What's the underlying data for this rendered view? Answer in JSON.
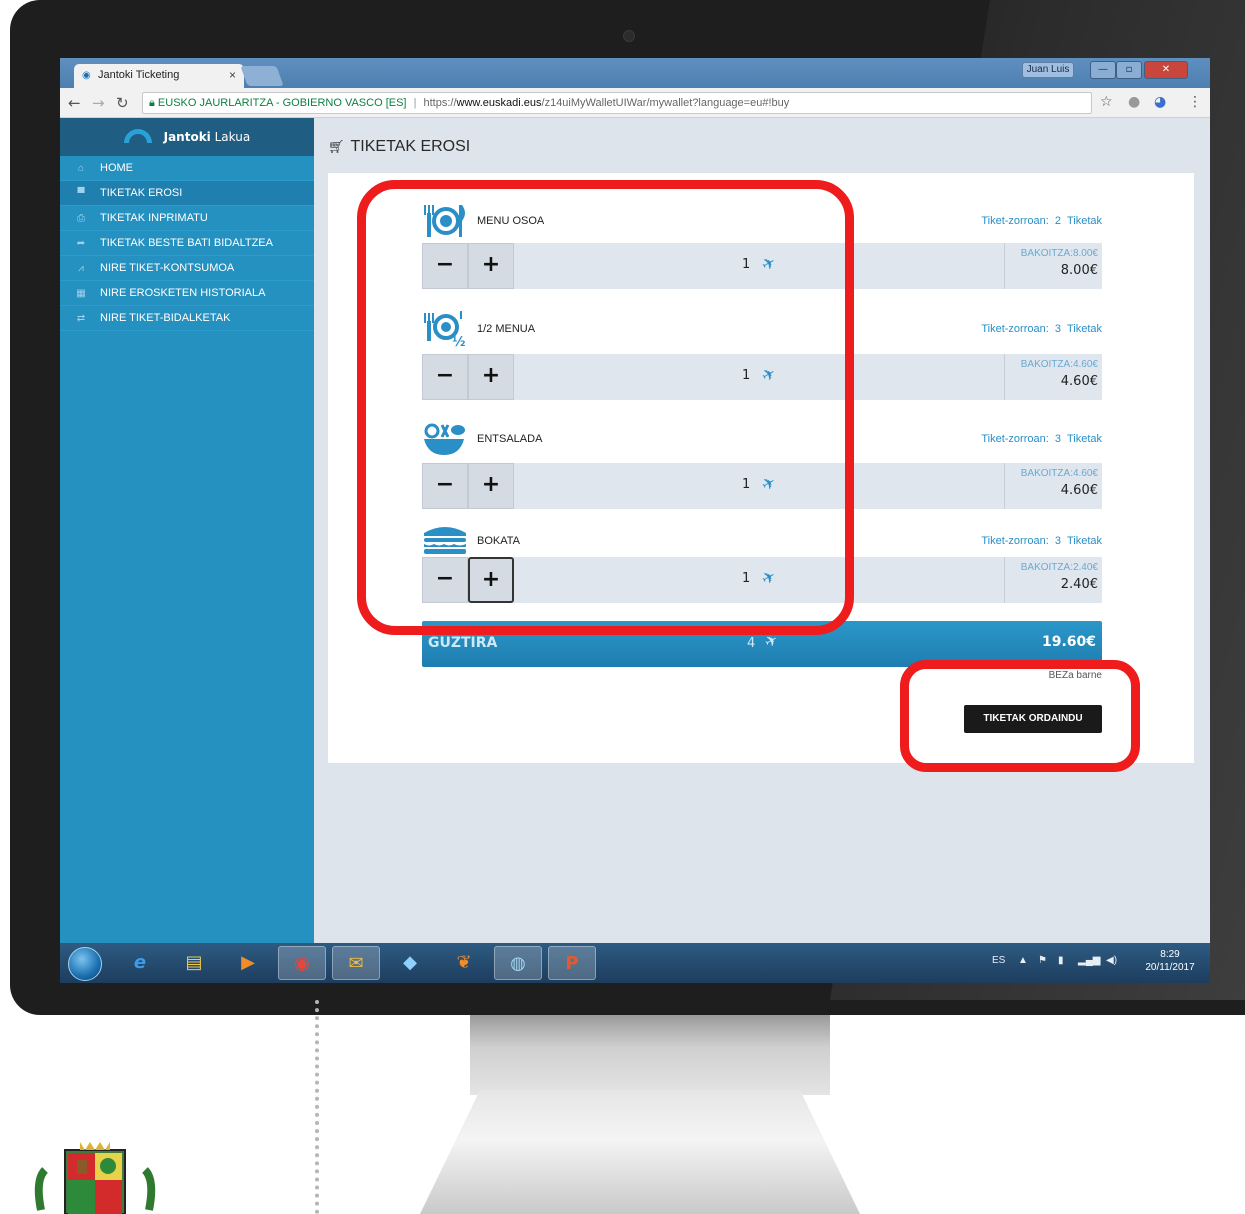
{
  "browser": {
    "tab_title": "Jantoki Ticketing",
    "tab_close": "×",
    "window_user": "Juan Luis",
    "url_org": "EUSKO JAURLARITZA - GOBIERNO VASCO [ES]",
    "url_separator": "|",
    "url_scheme": "https://",
    "url_host": "www.euskadi.eus",
    "url_path": "/z14uiMyWalletUIWar/mywallet?language=eu#!buy"
  },
  "sidebar": {
    "brand_strong": "Jantoki",
    "brand_rest": "Lakua",
    "items": [
      {
        "label": "HOME",
        "icon": "home-icon",
        "glyph": "⌂"
      },
      {
        "label": "TIKETAK EROSI",
        "icon": "cart-icon",
        "glyph": "▀"
      },
      {
        "label": "TIKETAK INPRIMATU",
        "icon": "print-icon",
        "glyph": "⎙"
      },
      {
        "label": "TIKETAK BESTE BATI BIDALTZEA",
        "icon": "share-icon",
        "glyph": "➦"
      },
      {
        "label": "NIRE TIKET-KONTSUMOA",
        "icon": "chart-icon",
        "glyph": "⩘"
      },
      {
        "label": "NIRE EROSKETEN HISTORIALA",
        "icon": "calculator-icon",
        "glyph": "▦"
      },
      {
        "label": "NIRE TIKET-BIDALKETAK",
        "icon": "transfer-icon",
        "glyph": "⇄"
      }
    ]
  },
  "main": {
    "page_title": "TIKETAK EROSI",
    "wallet_unit": "Tiketak",
    "wallet_prefix": "Tiket-zorroan:",
    "unit_price_label": "BAKOITZA:",
    "products": [
      {
        "name": "MENU OSOA",
        "icon": "full-menu-icon",
        "wallet_count": "2",
        "quantity": "1",
        "unit_price": "8.00€",
        "total": "8.00€"
      },
      {
        "name": "1/2 MENUA",
        "icon": "half-menu-icon",
        "wallet_count": "3",
        "quantity": "1",
        "unit_price": "4.60€",
        "total": "4.60€"
      },
      {
        "name": "ENTSALADA",
        "icon": "salad-icon",
        "wallet_count": "3",
        "quantity": "1",
        "unit_price": "4.60€",
        "total": "4.60€"
      },
      {
        "name": "BOKATA",
        "icon": "sandwich-icon",
        "wallet_count": "3",
        "quantity": "1",
        "unit_price": "2.40€",
        "total": "2.40€"
      }
    ],
    "total_label": "GUZTIRA",
    "total_count": "4",
    "total_sum": "19.60€",
    "vat_note": "BEZa barne",
    "pay_button": "TIKETAK ORDAINDU"
  },
  "taskbar": {
    "language": "ES",
    "time": "8:29",
    "date": "20/11/2017"
  },
  "colors": {
    "sidebar": "#2591c0",
    "accent": "#2a8fc6",
    "highlight": "#ee1c1c"
  }
}
